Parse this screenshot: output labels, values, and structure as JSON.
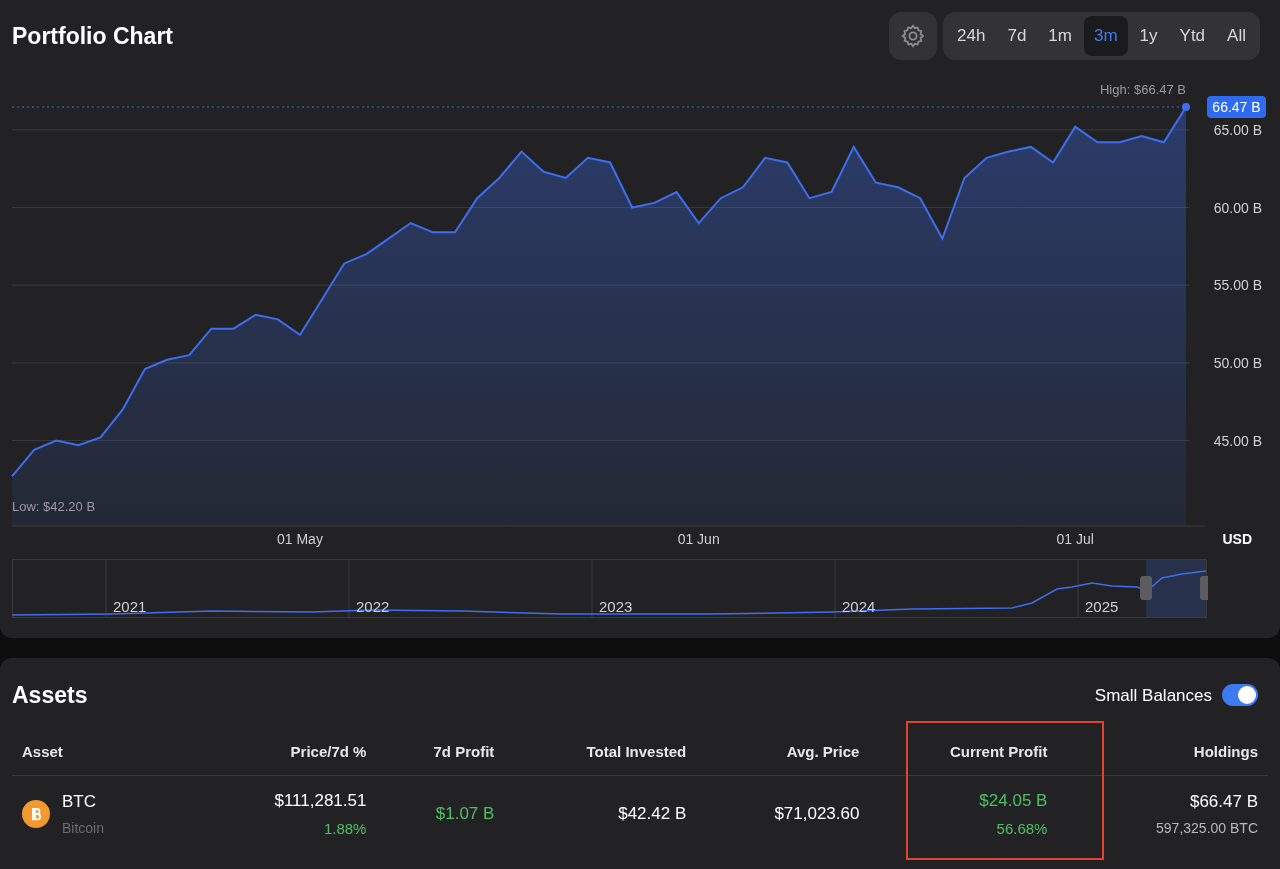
{
  "chart_panel": {
    "title": "Portfolio Chart",
    "ranges": [
      {
        "label": "24h",
        "selected": false
      },
      {
        "label": "7d",
        "selected": false
      },
      {
        "label": "1m",
        "selected": false
      },
      {
        "label": "3m",
        "selected": true
      },
      {
        "label": "1y",
        "selected": false
      },
      {
        "label": "Ytd",
        "selected": false
      },
      {
        "label": "All",
        "selected": false
      }
    ],
    "high_label": "High: $66.47 B",
    "low_label": "Low: $42.20 B",
    "currency": "USD",
    "chart_data": {
      "type": "area",
      "grid": true,
      "ref_lines": [
        {
          "label": "66.47 B"
        }
      ],
      "ylim": [
        39.5,
        66.47
      ],
      "categories": [
        null,
        null,
        null,
        null,
        null,
        null,
        null,
        null,
        null,
        null,
        null,
        null,
        null,
        "01 May",
        null,
        null,
        null,
        null,
        null,
        null,
        null,
        null,
        null,
        null,
        null,
        null,
        null,
        null,
        null,
        null,
        null,
        "01 Jun",
        null,
        null,
        null,
        null,
        null,
        null,
        null,
        null,
        null,
        null,
        null,
        null,
        null,
        null,
        null,
        null,
        "01 Jul",
        null,
        null,
        null,
        null,
        null
      ],
      "yticks": [
        {
          "value": 45,
          "label": "45.00 B"
        },
        {
          "value": 50,
          "label": "50.00 B"
        },
        {
          "value": 55,
          "label": "55.00 B"
        },
        {
          "value": 60,
          "label": "60.00 B"
        },
        {
          "value": 65,
          "label": "65.00 B"
        }
      ],
      "series": [
        {
          "color": "#3d6ef0",
          "values": [
            42.7,
            44.4,
            45,
            44.7,
            45.2,
            47,
            49.6,
            50.2,
            50.5,
            52.2,
            52.2,
            53.1,
            52.8,
            51.8,
            54.1,
            56.4,
            57,
            58,
            59,
            58.4,
            58.4,
            60.6,
            61.9,
            63.6,
            62.3,
            61.9,
            63.2,
            62.9,
            60,
            60.3,
            61,
            59,
            60.6,
            61.3,
            63.2,
            62.9,
            60.6,
            61,
            63.9,
            61.6,
            61.3,
            60.6,
            58,
            61.9,
            63.2,
            63.6,
            63.9,
            62.9,
            65.2,
            64.2,
            64.2,
            64.6,
            64.2,
            66.47
          ]
        }
      ]
    },
    "navigator": {
      "labels": [
        "2021",
        "2022",
        "2023",
        "2024",
        "2025"
      ]
    }
  },
  "assets_panel": {
    "title": "Assets",
    "small_balances": {
      "label": "Small Balances",
      "on": true
    },
    "columns": [
      "Asset",
      "Price/7d %",
      "7d Profit",
      "Total Invested",
      "Avg. Price",
      "Current Profit",
      "Holdings"
    ],
    "rows": [
      {
        "symbol": "BTC",
        "name": "Bitcoin",
        "price": "$111,281.51",
        "change_7d": "1.88%",
        "profit_7d": "$1.07 B",
        "total_invested": "$42.42 B",
        "avg_price": "$71,023.60",
        "current_profit": "$24.05 B",
        "current_profit_pct": "56.68%",
        "holdings_value": "$66.47 B",
        "holdings_amount": "597,325.00 BTC"
      }
    ]
  }
}
